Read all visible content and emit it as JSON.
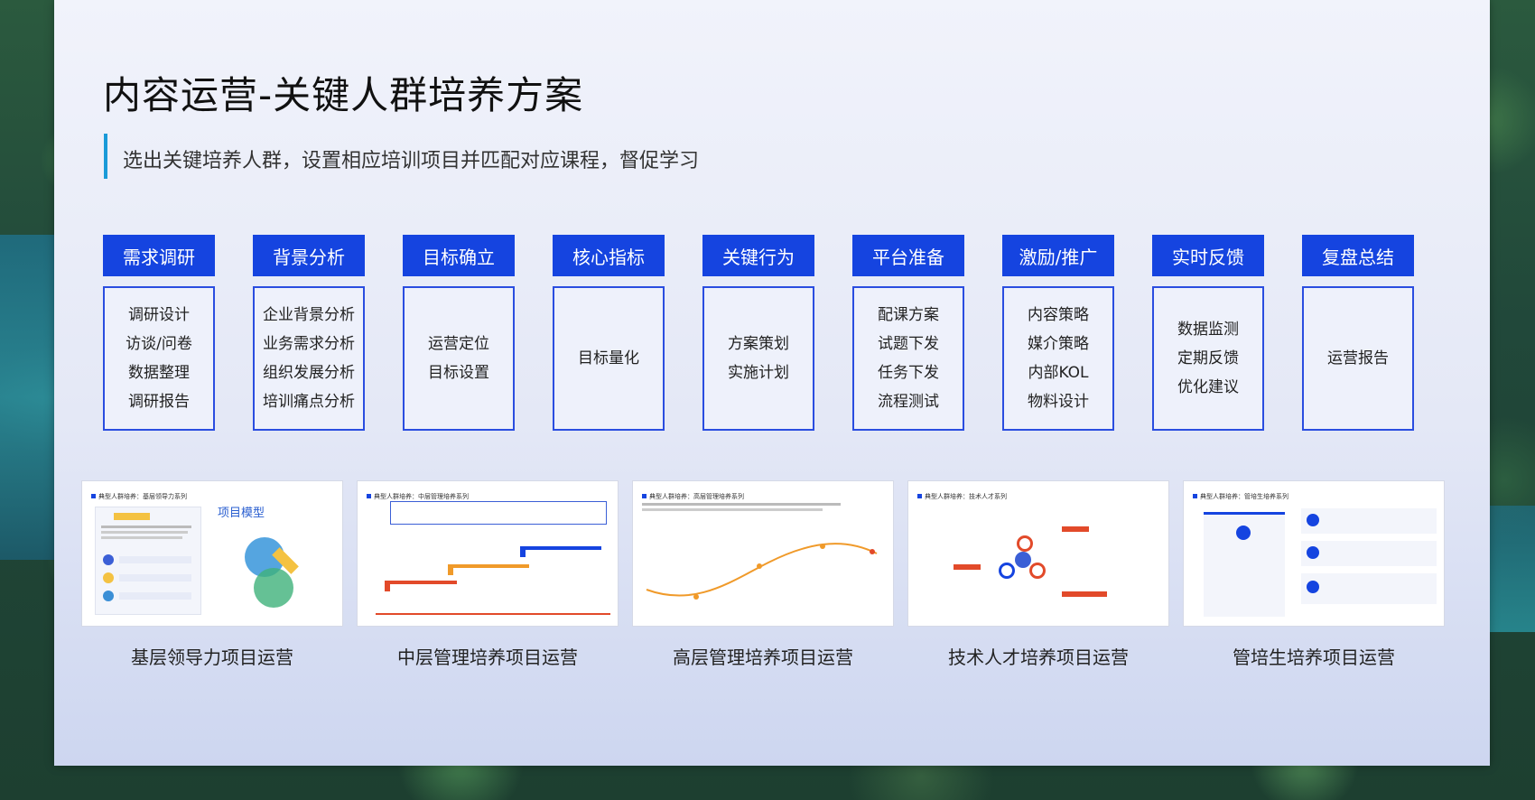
{
  "slide": {
    "title": "内容运营-关键人群培养方案",
    "subtitle": "选出关键培养人群，设置相应培训项目并匹配对应课程，督促学习"
  },
  "steps": [
    {
      "header": "需求调研",
      "items": [
        "调研设计",
        "访谈/问卷",
        "数据整理",
        "调研报告"
      ]
    },
    {
      "header": "背景分析",
      "items": [
        "企业背景分析",
        "业务需求分析",
        "组织发展分析",
        "培训痛点分析"
      ]
    },
    {
      "header": "目标确立",
      "items": [
        "运营定位",
        "目标设置"
      ]
    },
    {
      "header": "核心指标",
      "items": [
        "目标量化"
      ]
    },
    {
      "header": "关键行为",
      "items": [
        "方案策划",
        "实施计划"
      ]
    },
    {
      "header": "平台准备",
      "items": [
        "配课方案",
        "试题下发",
        "任务下发",
        "流程测试"
      ]
    },
    {
      "header": "激励/推广",
      "items": [
        "内容策略",
        "媒介策略",
        "内部KOL",
        "物料设计"
      ]
    },
    {
      "header": "实时反馈",
      "items": [
        "数据监测",
        "定期反馈",
        "优化建议"
      ]
    },
    {
      "header": "复盘总结",
      "items": [
        "运营报告"
      ]
    }
  ],
  "cards": [
    {
      "caption": "基层领导力项目运营",
      "thumb_title": "典型人群培养：基层领导力系列",
      "thumb_heading": "项目模型"
    },
    {
      "caption": "中层管理培养项目运营",
      "thumb_title": "典型人群培养：中层管理培养系列",
      "thumb_heading": ""
    },
    {
      "caption": "高层管理培养项目运营",
      "thumb_title": "典型人群培养：高层管理培养系列",
      "thumb_heading": ""
    },
    {
      "caption": "技术人才培养项目运营",
      "thumb_title": "典型人群培养：技术人才系列",
      "thumb_heading": ""
    },
    {
      "caption": "管培生培养项目运营",
      "thumb_title": "典型人群培养：管培生培养系列",
      "thumb_heading": ""
    }
  ],
  "colors": {
    "primary_blue": "#1544e0",
    "accent_cyan": "#1a9ad8",
    "background": "#e4e8f6"
  }
}
